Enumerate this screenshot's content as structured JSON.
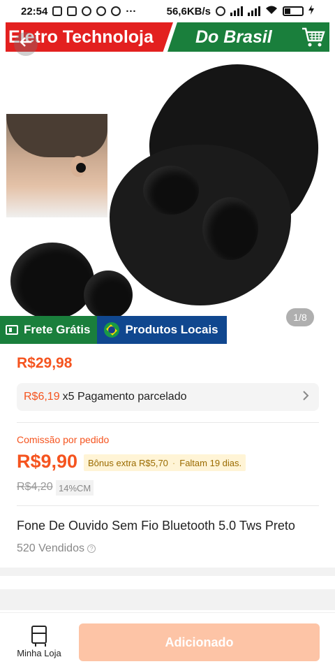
{
  "status_bar": {
    "time": "22:54",
    "speed": "56,6KB/s",
    "more": "···"
  },
  "banner": {
    "store_name": "Eletro Technoloja",
    "tagline": "Do Brasil",
    "icon": "shopping-cart-icon",
    "brand_red": "#e3201f",
    "brand_green": "#1a7f3c"
  },
  "gallery": {
    "counter": "1/8"
  },
  "tags": {
    "free_shipping": "Frete Grátis",
    "local_products": "Produtos Locais"
  },
  "product": {
    "price": "R$29,98",
    "installment_price": "R$6,19",
    "installment_text": "x5 Pagamento parcelado",
    "commission_label": "Comissão por pedido",
    "commission_price": "R$9,90",
    "bonus_text": "Bônus extra R$5,70",
    "bonus_deadline": "Faltam 19 dias.",
    "old_commission": "R$4,20",
    "commission_pct": "14%CM",
    "title": "Fone De Ouvido  Sem Fio  Bluetooth 5.0 Tws Preto",
    "sold": "520 Vendidos",
    "accent_color": "#f5541f"
  },
  "bottom_bar": {
    "store_label": "Minha Loja",
    "add_label": "Adicionado"
  }
}
